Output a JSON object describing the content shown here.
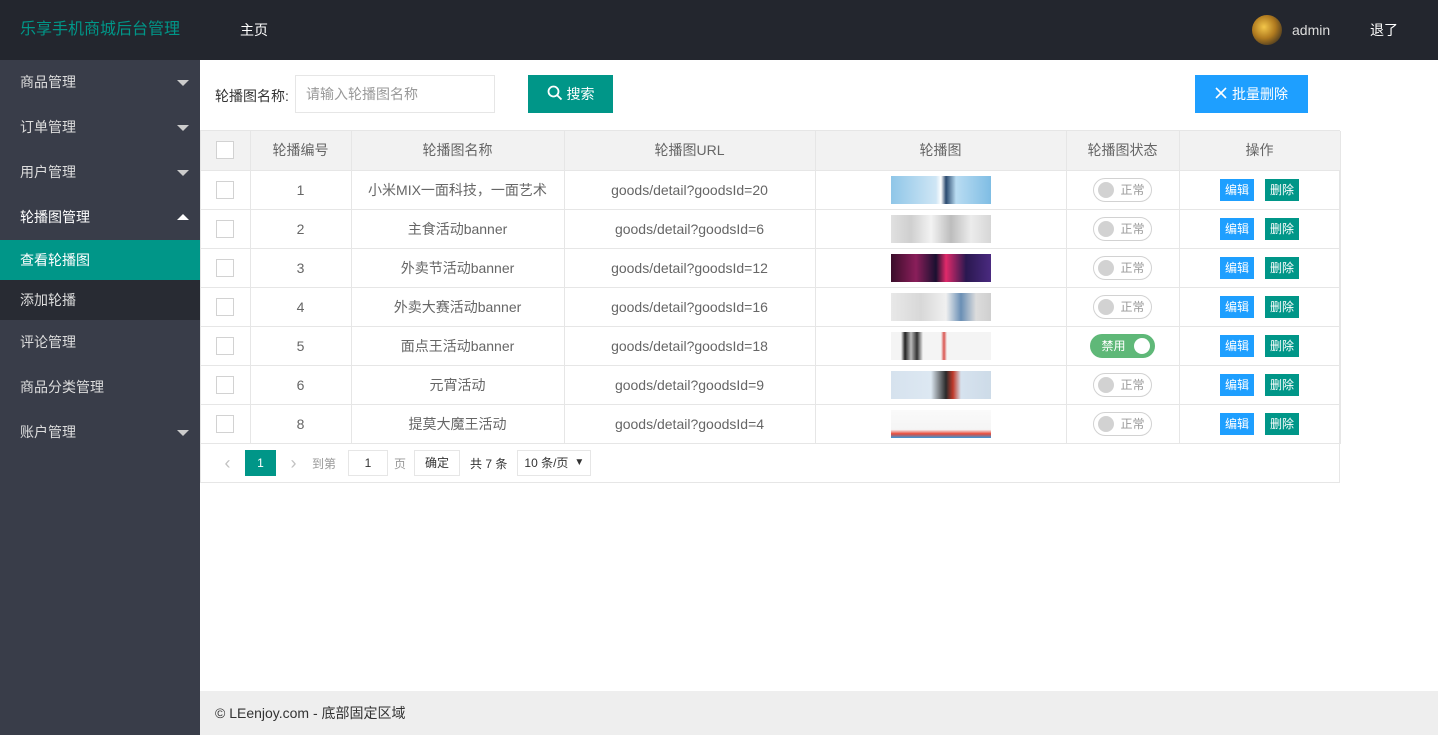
{
  "header": {
    "logo": "乐享手机商城后台管理",
    "nav_home": "主页",
    "username": "admin",
    "logout": "退了"
  },
  "sidebar": {
    "items": [
      {
        "label": "商品管理"
      },
      {
        "label": "订单管理"
      },
      {
        "label": "用户管理"
      },
      {
        "label": "轮播图管理"
      },
      {
        "label": "评论管理"
      },
      {
        "label": "商品分类管理"
      },
      {
        "label": "账户管理"
      }
    ],
    "sub_items": [
      {
        "label": "查看轮播图"
      },
      {
        "label": "添加轮播"
      }
    ]
  },
  "toolbar": {
    "search_label": "轮播图名称:",
    "search_placeholder": "请输入轮播图名称",
    "search_button": "搜索",
    "batch_delete_button": "批量删除"
  },
  "table": {
    "headers": [
      "轮播编号",
      "轮播图名称",
      "轮播图URL",
      "轮播图",
      "轮播图状态",
      "操作"
    ],
    "rows": [
      {
        "id": "1",
        "name": "小米MIX一面科技，一面艺术",
        "url": "goods/detail?goodsId=20",
        "status": "正常"
      },
      {
        "id": "2",
        "name": "主食活动banner",
        "url": "goods/detail?goodsId=6",
        "status": "正常"
      },
      {
        "id": "3",
        "name": "外卖节活动banner",
        "url": "goods/detail?goodsId=12",
        "status": "正常"
      },
      {
        "id": "4",
        "name": "外卖大赛活动banner",
        "url": "goods/detail?goodsId=16",
        "status": "正常"
      },
      {
        "id": "5",
        "name": "面点王活动banner",
        "url": "goods/detail?goodsId=18",
        "status": "禁用"
      },
      {
        "id": "6",
        "name": "元宵活动",
        "url": "goods/detail?goodsId=9",
        "status": "正常"
      },
      {
        "id": "8",
        "name": "提莫大魔王活动",
        "url": "goods/detail?goodsId=4",
        "status": "正常"
      }
    ],
    "edit_label": "编辑",
    "delete_label": "删除"
  },
  "pager": {
    "current": "1",
    "goto_prefix": "到第",
    "goto_value": "1",
    "goto_suffix": "页",
    "confirm": "确定",
    "total": "共 7 条",
    "page_size": "10 条/页"
  },
  "footer": {
    "text": "© LEenjoy.com - 底部固定区域"
  },
  "colors": {
    "header_bg": "#23262e",
    "sidebar_bg": "#393d49",
    "accent": "#009688",
    "primary_blue": "#1e9fff",
    "switch_on": "#5fb878"
  }
}
